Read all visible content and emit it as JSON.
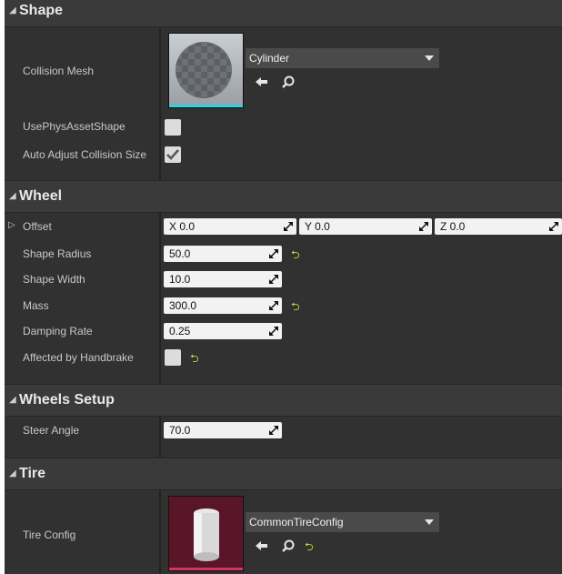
{
  "sections": {
    "shape": {
      "title": "Shape"
    },
    "wheel": {
      "title": "Wheel"
    },
    "wheels_setup": {
      "title": "Wheels Setup"
    },
    "tire": {
      "title": "Tire"
    }
  },
  "shape": {
    "collision_mesh_label": "Collision Mesh",
    "collision_mesh_value": "Cylinder",
    "use_phys_label": "UsePhysAssetShape",
    "auto_adjust_label": "Auto Adjust Collision Size",
    "use_phys_checked": false,
    "auto_adjust_checked": true
  },
  "wheel": {
    "offset_label": "Offset",
    "offset_x": "X  0.0",
    "offset_y": "Y  0.0",
    "offset_z": "Z  0.0",
    "shape_radius_label": "Shape Radius",
    "shape_radius": "50.0",
    "shape_width_label": "Shape Width",
    "shape_width": "10.0",
    "mass_label": "Mass",
    "mass": "300.0",
    "damping_label": "Damping Rate",
    "damping": "0.25",
    "handbrake_label": "Affected by Handbrake",
    "handbrake_checked": false
  },
  "wheels_setup": {
    "steer_label": "Steer Angle",
    "steer": "70.0"
  },
  "tire": {
    "config_label": "Tire Config",
    "config_value": "CommonTireConfig"
  },
  "colors": {
    "mesh_underline": "#29d4e6",
    "tire_underline": "#d6336c",
    "reset_arrow": "#d8d43a"
  },
  "icons": [
    "expand-triangle-icon",
    "dropdown-arrow-icon",
    "use-selected-arrow-icon",
    "browse-search-icon",
    "reset-to-default-icon",
    "drag-handle-icon",
    "checkmark-icon"
  ]
}
